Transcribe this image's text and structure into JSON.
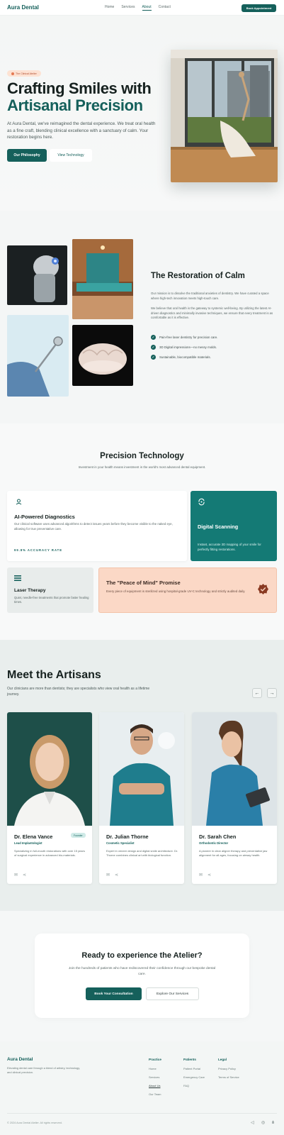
{
  "header": {
    "logo": "Aura Dental",
    "nav": [
      "Home",
      "Services",
      "About",
      "Contact"
    ],
    "active_nav": "About",
    "cta": "Book Appointment"
  },
  "hero": {
    "tag": "The Clinical Atelier",
    "title_line1": "Crafting Smiles with",
    "title_line2": "Artisanal Precision",
    "description": "At Aura Dental, we've reimagined the dental experience. We treat oral health as a fine craft, blending clinical excellence with a sanctuary of calm. Your restoration begins here.",
    "primary_button": "Our Philosophy",
    "secondary_button": "View Technology"
  },
  "restoration": {
    "title": "The Restoration of Calm",
    "paragraph1": "Our mission is to dissolve the traditional anxieties of dentistry. We have curated a space where high-tech innovation meets high-touch care.",
    "paragraph2": "We believe that oral health is the gateway to systemic well-being. By utilizing the latest AI-driven diagnostics and minimally invasive techniques, we ensure that every treatment is as comfortable as it is effective.",
    "checks": [
      "Pain-free laser dentistry for precision care.",
      "3D Digital impressions—no messy molds.",
      "Sustainable, biocompatible materials."
    ]
  },
  "technology": {
    "title": "Precision Technology",
    "subtitle": "Investment in your health means investment in the world's most advanced dental equipment.",
    "ai": {
      "title": "AI-Powered Diagnostics",
      "description": "Our clinical software uses advanced algorithms to detect issues years before they become visible to the naked eye, allowing for true preventative care.",
      "accuracy": "99.8% ACCURACY RATE"
    },
    "scanning": {
      "title": "Digital Scanning",
      "description": "Instant, accurate 3D mapping of your smile for perfectly fitting restorations."
    },
    "laser": {
      "title": "Laser Therapy",
      "description": "Quiet, needle-free treatments that promote faster healing times."
    },
    "promise": {
      "title": "The \"Peace of Mind\" Promise",
      "description": "Every piece of equipment is sterilized using hospital-grade UV-C technology and strictly audited daily."
    }
  },
  "artisans": {
    "title": "Meet the Artisans",
    "subtitle": "Our clinicians are more than dentists; they are specialists who view oral health as a lifetime journey.",
    "prev": "←",
    "next": "→",
    "doctors": [
      {
        "name": "Dr. Elena Vance",
        "role": "Lead Implantologist",
        "badge": "Founder",
        "bio": "Specializing in full-mouth restorations with over 15 years of surgical experience in advanced bio-materials."
      },
      {
        "name": "Dr. Julian Thorne",
        "role": "Cosmetic Specialist",
        "badge": "",
        "bio": "Expert in veneer design and digital smile architecture. Dr. Thorne combines clinical art with biological function."
      },
      {
        "name": "Dr. Sarah Chen",
        "role": "Orthodontic Director",
        "badge": "",
        "bio": "A pioneer in clear aligner therapy and preventative jaw alignment for all ages, focusing on airway health."
      }
    ]
  },
  "cta": {
    "title": "Ready to experience the Atelier?",
    "description": "Join the hundreds of patients who have rediscovered their confidence through our bespoke dental care.",
    "primary": "Book Your Consultation",
    "secondary": "Explore Our Services"
  },
  "footer": {
    "logo": "Aura Dental",
    "description": "Elevating dental care through a blend of artistry, technology, and clinical precision.",
    "columns": [
      {
        "title": "Practice",
        "links": [
          "Home",
          "Services",
          "About Us",
          "Our Team"
        ]
      },
      {
        "title": "Patients",
        "links": [
          "Patient Portal",
          "Emergency Care",
          "FAQ"
        ]
      },
      {
        "title": "Legal",
        "links": [
          "Privacy Policy",
          "Terms of Service"
        ]
      }
    ],
    "copyright": "© 2024 Aura Dental Atelier. All rights reserved."
  },
  "icons": {
    "check": "✓",
    "share": "share-icon",
    "mail": "mail-icon"
  },
  "colors": {
    "brand": "#15605b",
    "accent_teal": "#147a75",
    "peach": "#fbd8c6"
  }
}
